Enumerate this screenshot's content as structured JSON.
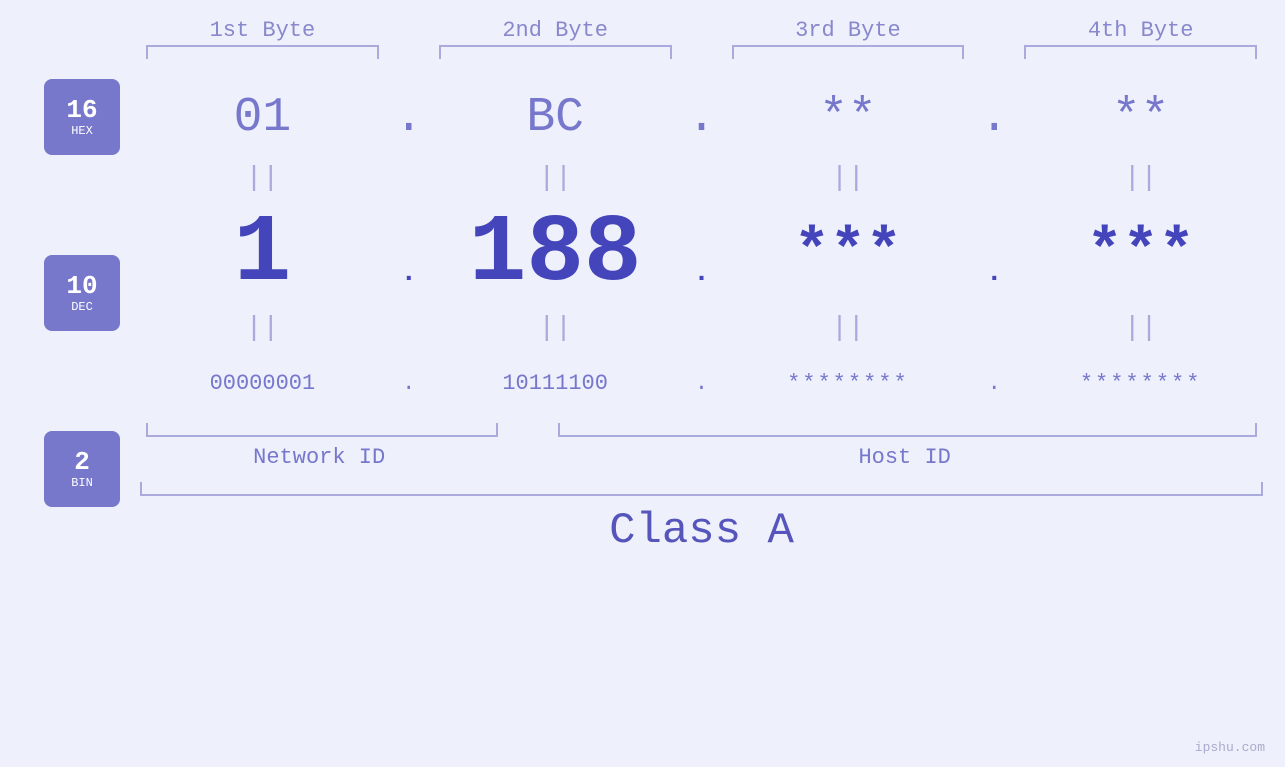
{
  "page": {
    "background": "#eef0fb",
    "watermark": "ipshu.com"
  },
  "byte_headers": [
    "1st Byte",
    "2nd Byte",
    "3rd Byte",
    "4th Byte"
  ],
  "badges": [
    {
      "number": "16",
      "label": "HEX"
    },
    {
      "number": "10",
      "label": "DEC"
    },
    {
      "number": "2",
      "label": "BIN"
    }
  ],
  "hex_row": {
    "values": [
      "01",
      "BC",
      "**",
      "**"
    ],
    "separators": [
      ".",
      ".",
      ".",
      ""
    ]
  },
  "dec_row": {
    "values": [
      "1",
      "188",
      "***",
      "***"
    ],
    "separators": [
      ".",
      ".",
      ".",
      ""
    ]
  },
  "bin_row": {
    "values": [
      "00000001",
      "10111100",
      "********",
      "********"
    ],
    "separators": [
      ".",
      ".",
      ".",
      ""
    ]
  },
  "labels": {
    "network_id": "Network ID",
    "host_id": "Host ID",
    "class": "Class A"
  },
  "colors": {
    "accent": "#7777cc",
    "dark_accent": "#4444bb",
    "light_accent": "#aaaadd",
    "badge_bg": "#7777cc",
    "text_medium": "#7777cc"
  }
}
